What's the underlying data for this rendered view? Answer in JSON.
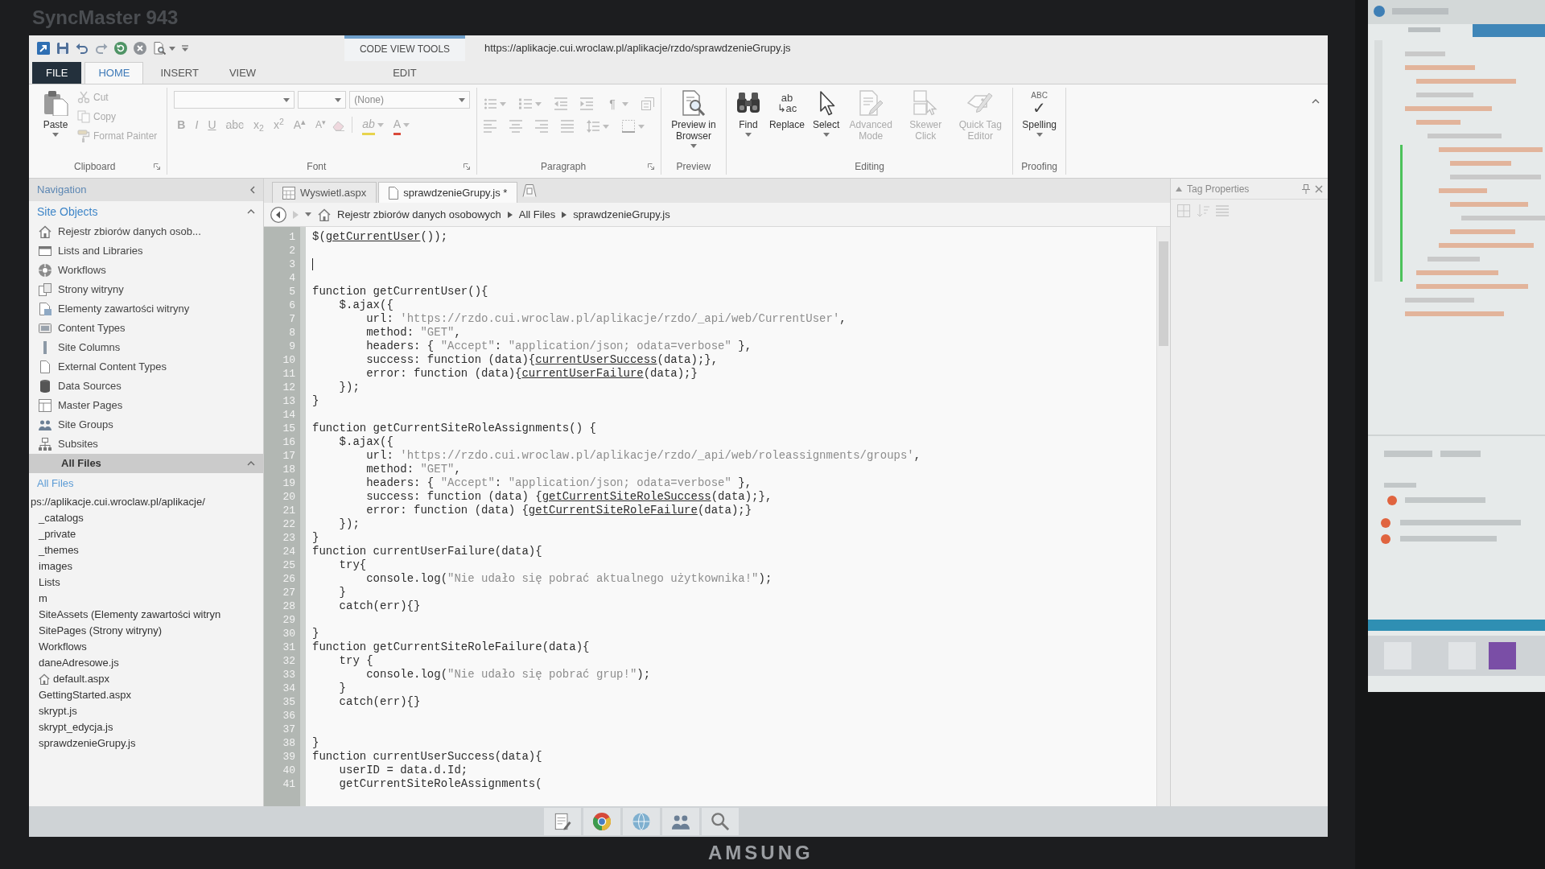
{
  "monitor": {
    "model": "SyncMaster 943",
    "brand": "AMSUNG"
  },
  "title_bar": {
    "contextual_group": "CODE VIEW TOOLS",
    "title": "https://aplikacje.cui.wroclaw.pl/aplikacje/rzdo/sprawdzenieGrupy.js"
  },
  "tabs": [
    {
      "label": "FILE",
      "kind": "file",
      "selected": false
    },
    {
      "label": "HOME",
      "kind": "main",
      "selected": true
    },
    {
      "label": "INSERT",
      "kind": "main",
      "selected": false
    },
    {
      "label": "VIEW",
      "kind": "main",
      "selected": false
    },
    {
      "label": "EDIT",
      "kind": "contextual",
      "selected": false
    }
  ],
  "ribbon": {
    "clipboard": {
      "label": "Clipboard",
      "paste": {
        "label": "Paste",
        "disabled": false
      },
      "buttons": [
        {
          "label": "Cut",
          "disabled": true
        },
        {
          "label": "Copy",
          "disabled": true
        },
        {
          "label": "Format Painter",
          "disabled": true
        }
      ]
    },
    "font": {
      "label": "Font",
      "style_field": {
        "value": "(None)"
      },
      "buttons": [
        {
          "label": "B",
          "kind": "bold",
          "disabled": true
        },
        {
          "label": "I",
          "kind": "italic",
          "disabled": true
        },
        {
          "label": "U",
          "kind": "underline",
          "disabled": true
        },
        {
          "label": "abc",
          "kind": "strikethrough",
          "disabled": true
        },
        {
          "label": "x$_{2}$",
          "kind": "subscript",
          "disabled": true
        },
        {
          "label": "x$^{2}$",
          "kind": "superscript",
          "disabled": true
        },
        {
          "label": "A$^{▴}$",
          "kind": "grow_font",
          "disabled": true
        },
        {
          "label": "A$^{▾}$",
          "kind": "shrink_font",
          "disabled": true
        },
        {
          "kind": "clear_formatting",
          "disabled": true
        },
        {
          "label": "ab",
          "kind": "highlight",
          "disabled": true
        },
        {
          "label": "A",
          "kind": "font_color",
          "disabled": true
        }
      ]
    },
    "paragraph": {
      "label": "Paragraph",
      "rows": [
        {
          "buttons": [
            {
              "kind": "bullets",
              "disabled": true
            },
            {
              "kind": "numbering",
              "disabled": true
            },
            {
              "kind": "outdent",
              "disabled": true
            },
            {
              "kind": "indent",
              "disabled": true
            },
            {
              "kind": "formatting_marks",
              "label": "¶",
              "disabled": true
            },
            {
              "kind": "text_direction",
              "disabled": true
            }
          ]
        },
        {
          "buttons": [
            {
              "kind": "align_left",
              "disabled": true
            },
            {
              "kind": "align_center",
              "disabled": true
            },
            {
              "kind": "align_right",
              "disabled": true
            },
            {
              "kind": "justify",
              "disabled": true
            },
            {
              "kind": "line_spacing",
              "disabled": true
            },
            {
              "kind": "borders",
              "disabled": true
            }
          ]
        }
      ]
    },
    "preview": {
      "label": "Preview",
      "button": {
        "label": "Preview in Browser",
        "disabled": false
      }
    },
    "editing": {
      "label": "Editing",
      "buttons": [
        {
          "kind": "find",
          "label": "Find",
          "disabled": false
        },
        {
          "kind": "replace",
          "label": "Replace",
          "icon_text": [
            "ab",
            "↳ac"
          ],
          "disabled": false
        },
        {
          "kind": "select",
          "label": "Select",
          "disabled": false
        },
        {
          "kind": "advanced_mode",
          "label": "Advanced Mode",
          "disabled": true
        },
        {
          "kind": "skewer_click",
          "label": "Skewer Click",
          "disabled": true
        },
        {
          "kind": "quick_tag",
          "label": "Quick Tag Editor",
          "disabled": true
        }
      ]
    },
    "proofing": {
      "label": "Proofing",
      "button": {
        "label": "Spelling",
        "icon_text": [
          "ABC",
          "✓"
        ],
        "disabled": false
      }
    }
  },
  "navigation": {
    "title": "Navigation",
    "site_objects": {
      "title": "Site Objects",
      "expanded": true,
      "items": [
        {
          "label": "Rejestr zbiorów danych osob...",
          "kind": "site",
          "selected": false
        },
        {
          "label": "Lists and Libraries",
          "kind": "lists",
          "selected": false
        },
        {
          "label": "Workflows",
          "kind": "workflows",
          "selected": false
        },
        {
          "label": "Strony witryny",
          "kind": "pages",
          "selected": false
        },
        {
          "label": "Elementy zawartości witryny",
          "kind": "assets",
          "selected": false
        },
        {
          "label": "Content Types",
          "kind": "content_types",
          "selected": false
        },
        {
          "label": "Site Columns",
          "kind": "columns",
          "selected": false
        },
        {
          "label": "External Content Types",
          "kind": "external_types",
          "selected": false
        },
        {
          "label": "Data Sources",
          "kind": "data_sources",
          "selected": false
        },
        {
          "label": "Master Pages",
          "kind": "master_pages",
          "selected": false
        },
        {
          "label": "Site Groups",
          "kind": "groups",
          "selected": false
        },
        {
          "label": "Subsites",
          "kind": "subsites",
          "selected": false
        }
      ]
    },
    "all_files": {
      "title": "All Files",
      "expanded": true,
      "subtitle": "All Files",
      "tree": [
        {
          "label": "ps://aplikacje.cui.wroclaw.pl/aplikacje/",
          "kind": "plain",
          "selected": false,
          "children": [
            {
              "label": "_catalogs",
              "kind": "plain",
              "selected": false
            },
            {
              "label": "_private",
              "kind": "plain",
              "selected": false
            },
            {
              "label": "_themes",
              "kind": "plain",
              "selected": false
            },
            {
              "label": "images",
              "kind": "plain",
              "selected": false
            },
            {
              "label": "Lists",
              "kind": "plain",
              "selected": false
            },
            {
              "label": "m",
              "kind": "plain",
              "selected": false
            },
            {
              "label": "SiteAssets (Elementy zawartości witryn",
              "kind": "plain",
              "selected": false
            },
            {
              "label": "SitePages (Strony witryny)",
              "kind": "plain",
              "selected": false
            },
            {
              "label": "Workflows",
              "kind": "plain",
              "selected": false
            },
            {
              "label": "daneAdresowe.js",
              "kind": "plain",
              "selected": false
            },
            {
              "label": "default.aspx",
              "kind": "home",
              "selected": false
            },
            {
              "label": "GettingStarted.aspx",
              "kind": "plain",
              "selected": false
            },
            {
              "label": "skrypt.js",
              "kind": "plain",
              "selected": false
            },
            {
              "label": "skrypt_edycja.js",
              "kind": "plain",
              "selected": false
            },
            {
              "label": "sprawdzenieGrupy.js",
              "kind": "plain",
              "selected": false
            }
          ]
        }
      ]
    }
  },
  "doc_tabs": [
    {
      "label": "Wyswietl.aspx",
      "kind": "aspx",
      "selected": false
    },
    {
      "label": "sprawdzenieGrupy.js *",
      "kind": "js",
      "selected": true
    }
  ],
  "breadcrumb": {
    "back": {
      "disabled": false
    },
    "forward": {
      "disabled": true
    },
    "items": [
      "Rejestr zbiorów danych osobowych",
      "All Files",
      "sprawdzenieGrupy.js"
    ]
  },
  "editor": {
    "lines": [
      {
        "number": "1",
        "caret": false,
        "tokens": [
          {
            "kind": "code",
            "text": "$("
          },
          {
            "kind": "ref",
            "text": "getCurrentUser"
          },
          {
            "kind": "code",
            "text": "());"
          }
        ]
      },
      {
        "number": "2",
        "caret": false
      },
      {
        "number": "3",
        "caret": true
      },
      {
        "number": "4",
        "caret": false
      },
      {
        "number": "5",
        "caret": false,
        "tokens": [
          {
            "kind": "code",
            "text": "function getCurrentUser(){"
          }
        ]
      },
      {
        "number": "6",
        "caret": false,
        "tokens": [
          {
            "kind": "code",
            "text": "    $.ajax({"
          }
        ]
      },
      {
        "number": "7",
        "caret": false,
        "tokens": [
          {
            "kind": "code",
            "text": "        url: "
          },
          {
            "kind": "string",
            "text": "'https://rzdo.cui.wroclaw.pl/aplikacje/rzdo/_api/web/CurrentUser'"
          },
          {
            "kind": "code",
            "text": ","
          }
        ]
      },
      {
        "number": "8",
        "caret": false,
        "tokens": [
          {
            "kind": "code",
            "text": "        method: "
          },
          {
            "kind": "string",
            "text": "\"GET\""
          },
          {
            "kind": "code",
            "text": ","
          }
        ]
      },
      {
        "number": "9",
        "caret": false,
        "tokens": [
          {
            "kind": "code",
            "text": "        headers: { "
          },
          {
            "kind": "string",
            "text": "\"Accept\""
          },
          {
            "kind": "code",
            "text": ": "
          },
          {
            "kind": "string",
            "text": "\"application/json; odata=verbose\""
          },
          {
            "kind": "code",
            "text": " },"
          }
        ]
      },
      {
        "number": "10",
        "caret": false,
        "tokens": [
          {
            "kind": "code",
            "text": "        success: function (data){"
          },
          {
            "kind": "ref",
            "text": "currentUserSuccess"
          },
          {
            "kind": "code",
            "text": "(data);},"
          }
        ]
      },
      {
        "number": "11",
        "caret": false,
        "tokens": [
          {
            "kind": "code",
            "text": "        error: function (data){"
          },
          {
            "kind": "ref",
            "text": "currentUserFailure"
          },
          {
            "kind": "code",
            "text": "(data);}"
          }
        ]
      },
      {
        "number": "12",
        "caret": false,
        "tokens": [
          {
            "kind": "code",
            "text": "    });"
          }
        ]
      },
      {
        "number": "13",
        "caret": false,
        "tokens": [
          {
            "kind": "code",
            "text": "}"
          }
        ]
      },
      {
        "number": "14",
        "caret": false
      },
      {
        "number": "15",
        "caret": false,
        "tokens": [
          {
            "kind": "code",
            "text": "function getCurrentSiteRoleAssignments() {"
          }
        ]
      },
      {
        "number": "16",
        "caret": false,
        "tokens": [
          {
            "kind": "code",
            "text": "    $.ajax({"
          }
        ]
      },
      {
        "number": "17",
        "caret": false,
        "tokens": [
          {
            "kind": "code",
            "text": "        url: "
          },
          {
            "kind": "string",
            "text": "'https://rzdo.cui.wroclaw.pl/aplikacje/rzdo/_api/web/roleassignments/groups'"
          },
          {
            "kind": "code",
            "text": ","
          }
        ]
      },
      {
        "number": "18",
        "caret": false,
        "tokens": [
          {
            "kind": "code",
            "text": "        method: "
          },
          {
            "kind": "string",
            "text": "\"GET\""
          },
          {
            "kind": "code",
            "text": ","
          }
        ]
      },
      {
        "number": "19",
        "caret": false,
        "tokens": [
          {
            "kind": "code",
            "text": "        headers: { "
          },
          {
            "kind": "string",
            "text": "\"Accept\""
          },
          {
            "kind": "code",
            "text": ": "
          },
          {
            "kind": "string",
            "text": "\"application/json; odata=verbose\""
          },
          {
            "kind": "code",
            "text": " },"
          }
        ]
      },
      {
        "number": "20",
        "caret": false,
        "tokens": [
          {
            "kind": "code",
            "text": "        success: function (data) {"
          },
          {
            "kind": "ref",
            "text": "getCurrentSiteRoleSuccess"
          },
          {
            "kind": "code",
            "text": "(data);},"
          }
        ]
      },
      {
        "number": "21",
        "caret": false,
        "tokens": [
          {
            "kind": "code",
            "text": "        error: function (data) {"
          },
          {
            "kind": "ref",
            "text": "getCurrentSiteRoleFailure"
          },
          {
            "kind": "code",
            "text": "(data);}"
          }
        ]
      },
      {
        "number": "22",
        "caret": false,
        "tokens": [
          {
            "kind": "code",
            "text": "    });"
          }
        ]
      },
      {
        "number": "23",
        "caret": false,
        "tokens": [
          {
            "kind": "code",
            "text": "}"
          }
        ]
      },
      {
        "number": "24",
        "caret": false,
        "tokens": [
          {
            "kind": "code",
            "text": "function currentUserFailure(data){"
          }
        ]
      },
      {
        "number": "25",
        "caret": false,
        "tokens": [
          {
            "kind": "code",
            "text": "    try{"
          }
        ]
      },
      {
        "number": "26",
        "caret": false,
        "tokens": [
          {
            "kind": "code",
            "text": "        console.log("
          },
          {
            "kind": "string",
            "text": "\"Nie udało się pobrać aktualnego użytkownika!\""
          },
          {
            "kind": "code",
            "text": ");"
          }
        ]
      },
      {
        "number": "27",
        "caret": false,
        "tokens": [
          {
            "kind": "code",
            "text": "    }"
          }
        ]
      },
      {
        "number": "28",
        "caret": false,
        "tokens": [
          {
            "kind": "code",
            "text": "    catch(err){}"
          }
        ]
      },
      {
        "number": "29",
        "caret": false
      },
      {
        "number": "30",
        "caret": false,
        "tokens": [
          {
            "kind": "code",
            "text": "}"
          }
        ]
      },
      {
        "number": "31",
        "caret": false,
        "tokens": [
          {
            "kind": "code",
            "text": "function getCurrentSiteRoleFailure(data){"
          }
        ]
      },
      {
        "number": "32",
        "caret": false,
        "tokens": [
          {
            "kind": "code",
            "text": "    try {"
          }
        ]
      },
      {
        "number": "33",
        "caret": false,
        "tokens": [
          {
            "kind": "code",
            "text": "        console.log("
          },
          {
            "kind": "string",
            "text": "\"Nie udało się pobrać grup!\""
          },
          {
            "kind": "code",
            "text": ");"
          }
        ]
      },
      {
        "number": "34",
        "caret": false,
        "tokens": [
          {
            "kind": "code",
            "text": "    }"
          }
        ]
      },
      {
        "number": "35",
        "caret": false,
        "tokens": [
          {
            "kind": "code",
            "text": "    catch(err){}"
          }
        ]
      },
      {
        "number": "36",
        "caret": false
      },
      {
        "number": "37",
        "caret": false
      },
      {
        "number": "38",
        "caret": false,
        "tokens": [
          {
            "kind": "code",
            "text": "}"
          }
        ]
      },
      {
        "number": "39",
        "caret": false,
        "tokens": [
          {
            "kind": "code",
            "text": "function currentUserSuccess(data){"
          }
        ]
      },
      {
        "number": "40",
        "caret": false,
        "tokens": [
          {
            "kind": "code",
            "text": "    userID = data.d.Id;"
          }
        ]
      },
      {
        "number": "41",
        "caret": false,
        "tokens": [
          {
            "kind": "code",
            "text": "    getCurrentSiteRoleAssignments("
          }
        ]
      }
    ]
  },
  "tag_properties": {
    "title": "Tag Properties"
  }
}
